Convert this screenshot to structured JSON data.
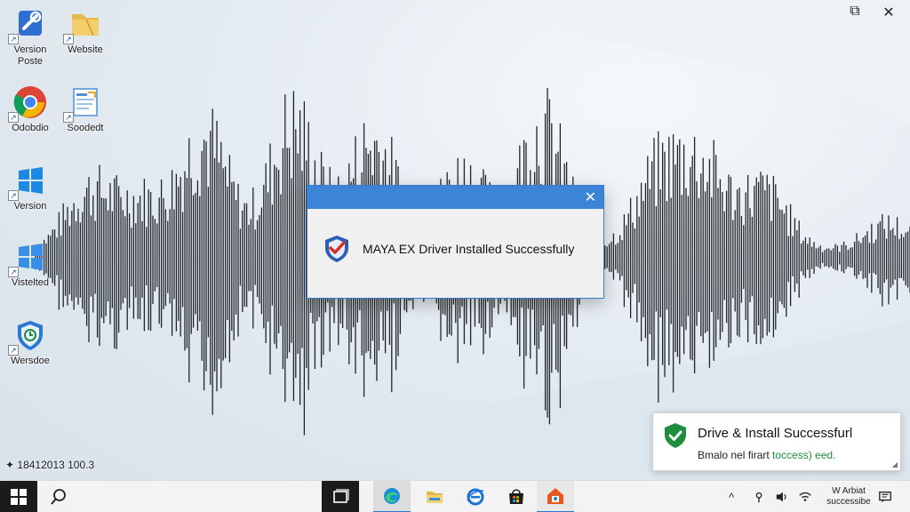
{
  "desktop": {
    "icons": [
      {
        "label": "Version Poste"
      },
      {
        "label": "Website"
      },
      {
        "label": "Odobdio"
      },
      {
        "label": "Soodedt"
      },
      {
        "label": "Version"
      },
      {
        "label": "Vistelted"
      },
      {
        "label": "Wersdoe"
      }
    ],
    "build_info": "18412013 100.3"
  },
  "window_controls": {
    "restore": "⧉",
    "close": "✕"
  },
  "dialog": {
    "close": "✕",
    "message": "MAYA EX Driver Installed Successfully",
    "icon": "check-shield-icon",
    "accent": "#3b84d6"
  },
  "toast": {
    "title": "Drive & Install Successfurl",
    "subtitle_plain": "Bmalo nel firart",
    "subtitle_green": "toccess) eed.",
    "icon": "green-check-icon",
    "accent": "#1e8e3e"
  },
  "taskbar": {
    "tray_chevron": "^",
    "clock_line1": "W Arbiat",
    "clock_line2": "successibe"
  }
}
